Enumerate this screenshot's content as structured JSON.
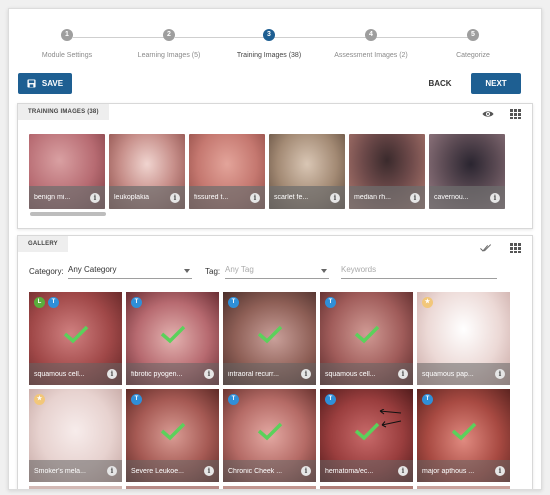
{
  "stepper": [
    {
      "num": "1",
      "label": "Module Settings"
    },
    {
      "num": "2",
      "label": "Learning Images (5)"
    },
    {
      "num": "3",
      "label": "Training Images (38)"
    },
    {
      "num": "4",
      "label": "Assessment Images (2)"
    },
    {
      "num": "5",
      "label": "Categorize"
    }
  ],
  "actions": {
    "save": "SAVE",
    "back": "BACK",
    "next": "NEXT"
  },
  "training": {
    "title": "TRAINING IMAGES (38)",
    "items": [
      {
        "caption": "benign mi...",
        "color": "#b76b72"
      },
      {
        "caption": "leukoplakia",
        "color": "#c78f8a"
      },
      {
        "caption": "fissured t...",
        "color": "#c57870"
      },
      {
        "caption": "scarlet fe...",
        "color": "#a38a74"
      },
      {
        "caption": "median rh...",
        "color": "#6e4a4a"
      },
      {
        "caption": "cavernou...",
        "color": "#5c4b54"
      }
    ]
  },
  "gallery": {
    "title": "GALLERY",
    "category_label": "Category:",
    "category_value": "Any Category",
    "tag_label": "Tag:",
    "tag_placeholder": "Any Tag",
    "keywords_placeholder": "Keywords",
    "items": [
      {
        "caption": "squamous cell...",
        "badges": [
          "L",
          "T"
        ],
        "checked": true,
        "color": "#a04848"
      },
      {
        "caption": "fibrotic pyogen...",
        "badges": [
          "T"
        ],
        "checked": true,
        "color": "#b76a70"
      },
      {
        "caption": "intraoral recurr...",
        "badges": [
          "T"
        ],
        "checked": true,
        "color": "#8e5f56"
      },
      {
        "caption": "squamous cell...",
        "badges": [
          "T"
        ],
        "checked": true,
        "color": "#a05c5a"
      },
      {
        "caption": "squamous pap...",
        "badges": [
          "★"
        ],
        "checked": false,
        "color": "#ecd9d6"
      },
      {
        "caption": "Smoker's mela...",
        "badges": [
          "★"
        ],
        "checked": false,
        "color": "#e7d2cf"
      },
      {
        "caption": "Severe Leukoe...",
        "badges": [
          "T"
        ],
        "checked": true,
        "color": "#a65a54"
      },
      {
        "caption": "Chronic Cheek ...",
        "badges": [
          "T"
        ],
        "checked": true,
        "color": "#b56b66"
      },
      {
        "caption": "hematoma/ec...",
        "badges": [
          "T"
        ],
        "checked": true,
        "color": "#9a3e3e"
      },
      {
        "caption": "major apthous ...",
        "badges": [
          "T"
        ],
        "checked": true,
        "color": "#a84a42"
      }
    ]
  }
}
